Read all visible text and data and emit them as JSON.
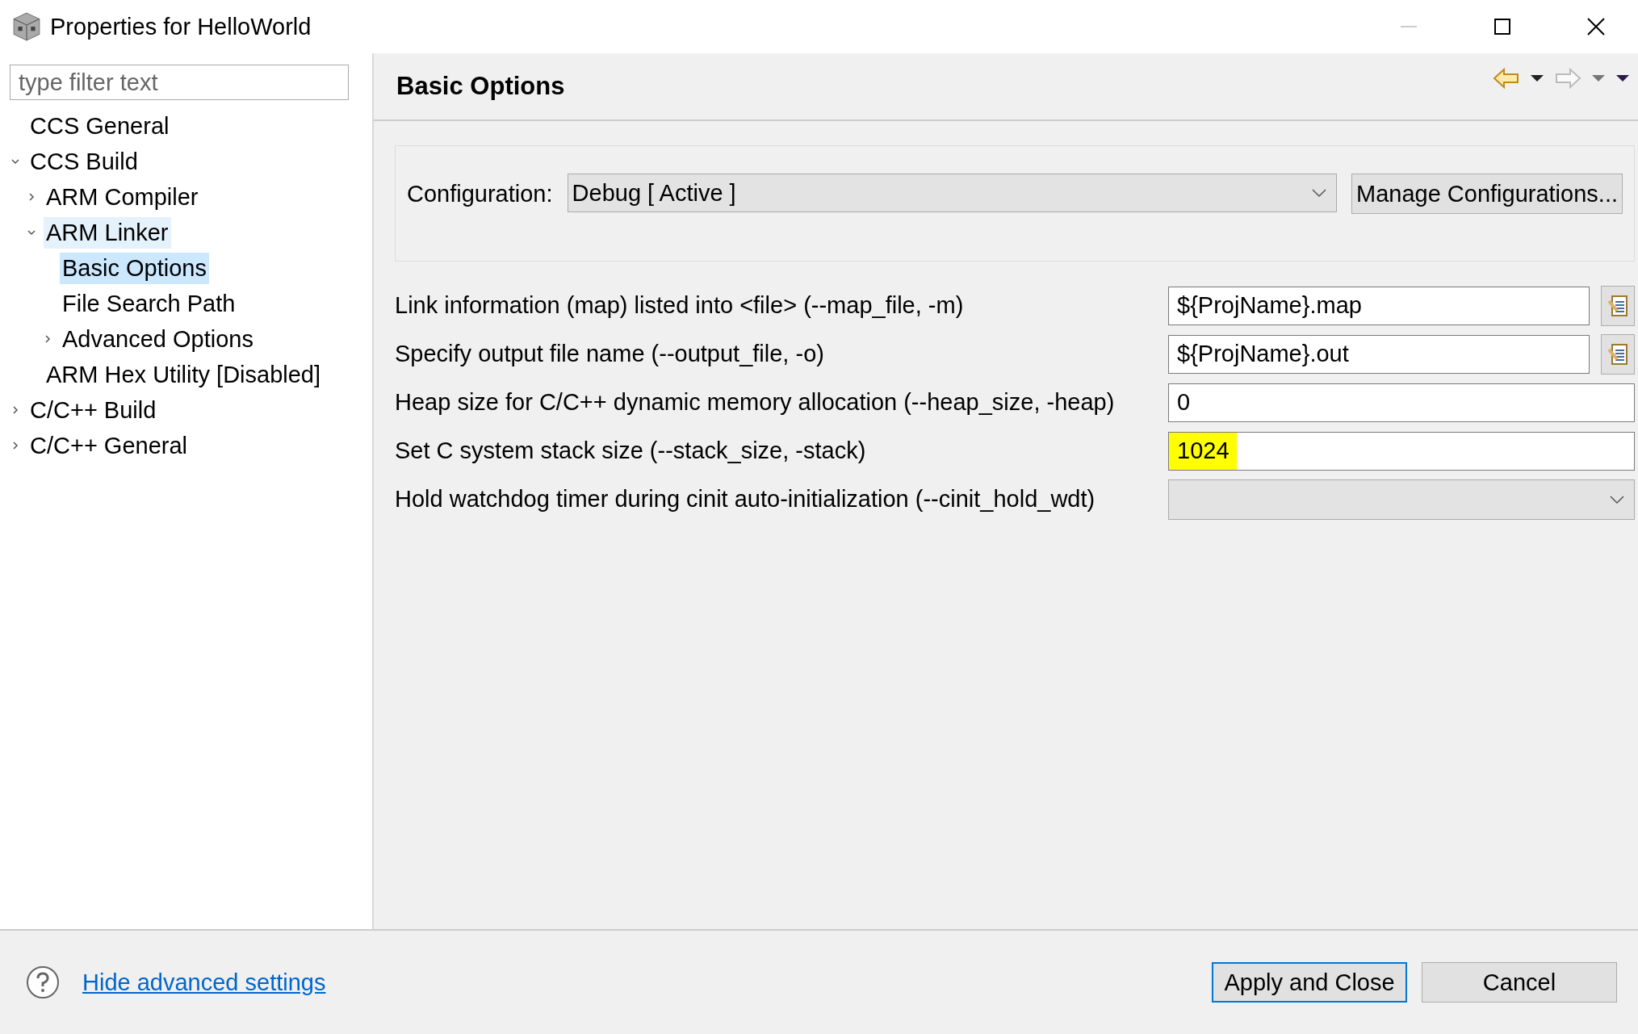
{
  "window": {
    "title": "Properties for HelloWorld"
  },
  "filter": {
    "placeholder": "type filter text"
  },
  "tree": [
    {
      "label": "CCS General",
      "selected": false,
      "hovered": false
    },
    {
      "label": "CCS Build",
      "expanded": true,
      "selected": false,
      "hovered": false,
      "children": [
        {
          "label": "ARM Compiler",
          "expanded": false,
          "selected": false,
          "hovered": false
        },
        {
          "label": "ARM Linker",
          "expanded": true,
          "selected": false,
          "hovered": true,
          "children": [
            {
              "label": "Basic Options",
              "selected": true,
              "hovered": false
            },
            {
              "label": "File Search Path",
              "selected": false,
              "hovered": false
            },
            {
              "label": "Advanced Options",
              "expanded": false,
              "selected": false,
              "hovered": false
            }
          ]
        },
        {
          "label": "ARM Hex Utility  [Disabled]",
          "selected": false,
          "hovered": false
        }
      ]
    },
    {
      "label": "C/C++ Build",
      "expanded": false,
      "selected": false,
      "hovered": false
    },
    {
      "label": "C/C++ General",
      "expanded": false,
      "selected": false,
      "hovered": false
    }
  ],
  "page": {
    "title": "Basic Options",
    "configuration": {
      "label": "Configuration:",
      "value": "Debug  [ Active ]",
      "button": "Manage Configurations..."
    },
    "options": [
      {
        "kind": "file",
        "label": "Link information (map) listed into <file> (--map_file, -m)",
        "value": "${ProjName}.map"
      },
      {
        "kind": "file",
        "label": "Specify output file name (--output_file, -o)",
        "value": "${ProjName}.out"
      },
      {
        "kind": "text",
        "label": "Heap size for C/C++ dynamic memory allocation (--heap_size, -heap)",
        "value": "0"
      },
      {
        "kind": "text",
        "label": "Set C system stack size (--stack_size, -stack)",
        "value": "1024",
        "highlighted": true
      },
      {
        "kind": "dropdown",
        "label": "Hold watchdog timer during cinit auto-initialization (--cinit_hold_wdt)"
      }
    ]
  },
  "footer": {
    "link": "Hide advanced settings",
    "buttons": [
      {
        "label": "Apply and Close",
        "default": true
      },
      {
        "label": "Cancel",
        "default": false
      }
    ]
  }
}
